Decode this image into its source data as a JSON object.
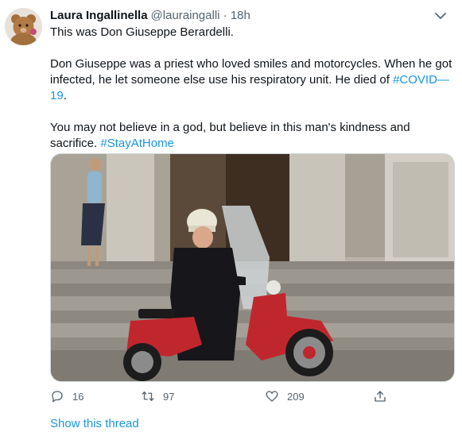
{
  "tweet": {
    "author_name": "Laura Ingallinella",
    "handle": "@lauraingalli",
    "separator": "·",
    "time": "18h",
    "para1": "This was Don Giuseppe Berardelli.",
    "para2_text": "Don Giuseppe was a priest who loved smiles and motorcycles. When he got infected, he let someone else use his respiratory unit. He died of ",
    "para2_hashtag": "#COVID—19",
    "para2_end": ".",
    "para3_text": "You may not believe in a god, but believe in this man's kindness and sacrifice. ",
    "para3_hashtag": "#StayAtHome"
  },
  "actions": {
    "reply_count": "16",
    "retweet_count": "97",
    "like_count": "209"
  },
  "show_thread": "Show this thread",
  "colors": {
    "link": "#1b95e0",
    "muted": "#536471",
    "text": "#0f1419"
  },
  "icons": [
    "teddy-bear-avatar",
    "chevron-down-icon",
    "reply-icon",
    "retweet-icon",
    "like-icon",
    "share-icon"
  ]
}
